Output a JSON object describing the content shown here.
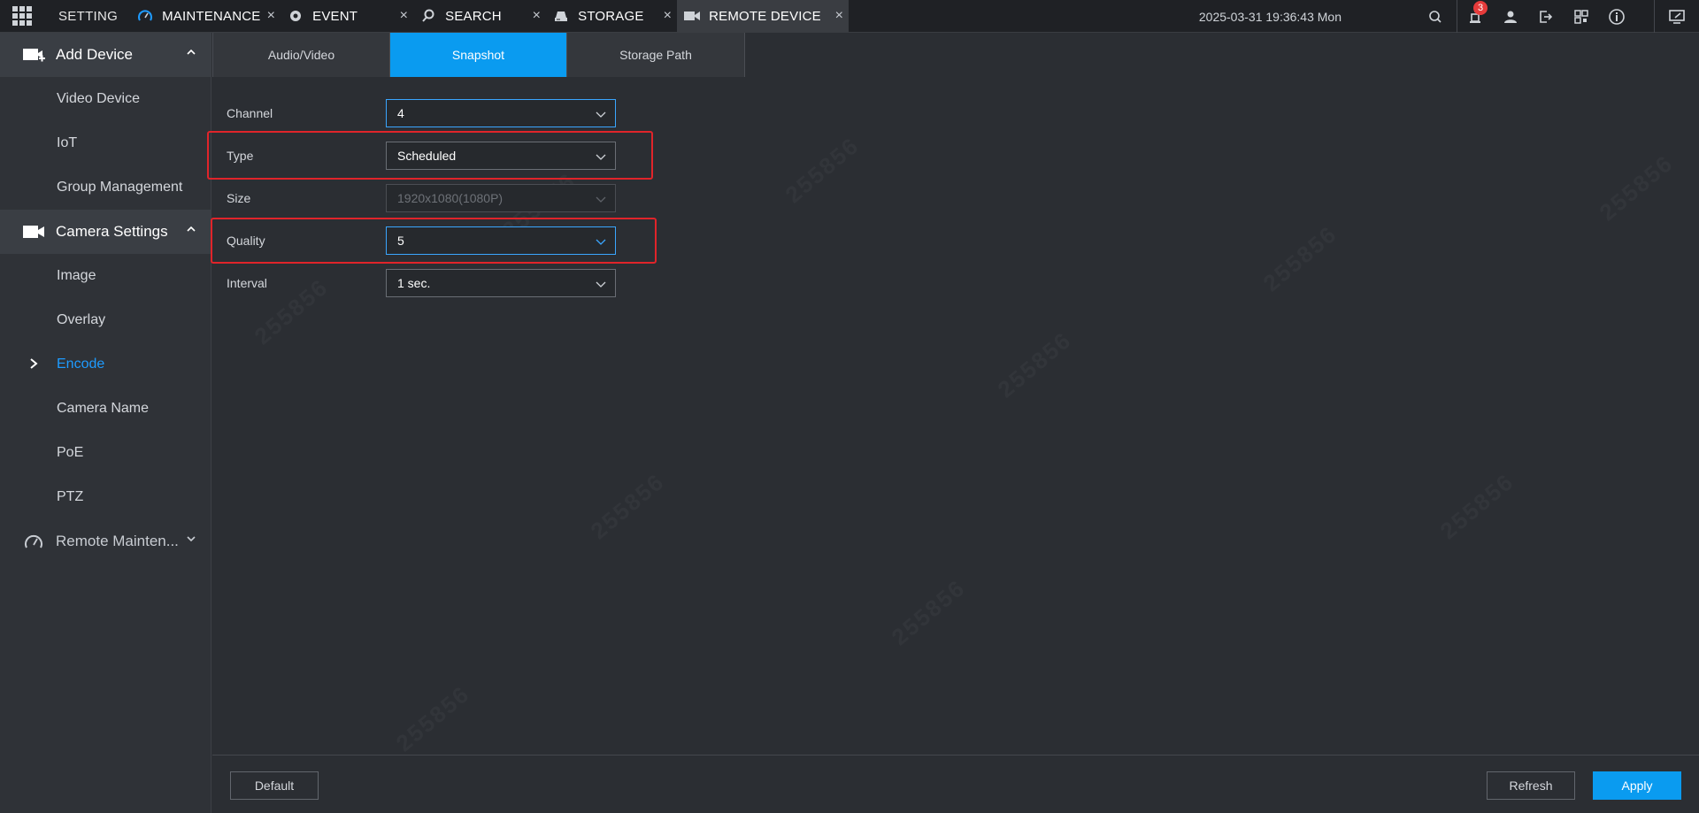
{
  "topbar": {
    "setting_label": "SETTING",
    "tabs": [
      {
        "label": "MAINTENANCE",
        "icon": "gauge-icon",
        "active": false
      },
      {
        "label": "EVENT",
        "icon": "event-icon",
        "active": false
      },
      {
        "label": "SEARCH",
        "icon": "search-icon",
        "active": false
      },
      {
        "label": "STORAGE",
        "icon": "storage-icon",
        "active": false
      },
      {
        "label": "REMOTE DEVICE",
        "icon": "camera-icon",
        "active": true
      }
    ],
    "close_glyph": "×",
    "datetime": "2025-03-31 19:36:43 Mon",
    "alarm_count": "3"
  },
  "sidebar": {
    "groups": [
      {
        "label": "Add Device",
        "icon": "add-device-icon",
        "expanded": true,
        "items": [
          "Video Device",
          "IoT",
          "Group Management"
        ]
      },
      {
        "label": "Camera Settings",
        "icon": "camera-icon",
        "expanded": true,
        "items": [
          "Image",
          "Overlay",
          "Encode",
          "Camera Name",
          "PoE",
          "PTZ"
        ]
      },
      {
        "label": "Remote Mainten...",
        "icon": "gauge-icon",
        "expanded": false,
        "items": []
      }
    ],
    "active_item": "Encode"
  },
  "content": {
    "subtabs": [
      "Audio/Video",
      "Snapshot",
      "Storage Path"
    ],
    "active_subtab": "Snapshot",
    "form": {
      "channel": {
        "label": "Channel",
        "value": "4"
      },
      "type": {
        "label": "Type",
        "value": "Scheduled"
      },
      "size": {
        "label": "Size",
        "value": "1920x1080(1080P)"
      },
      "quality": {
        "label": "Quality",
        "value": "5"
      },
      "interval": {
        "label": "Interval",
        "value": "1 sec."
      }
    }
  },
  "footer": {
    "default_label": "Default",
    "refresh_label": "Refresh",
    "apply_label": "Apply"
  },
  "colors": {
    "accent": "#0a9bf0",
    "highlight": "#e0242a",
    "background": "#2b2e33"
  }
}
